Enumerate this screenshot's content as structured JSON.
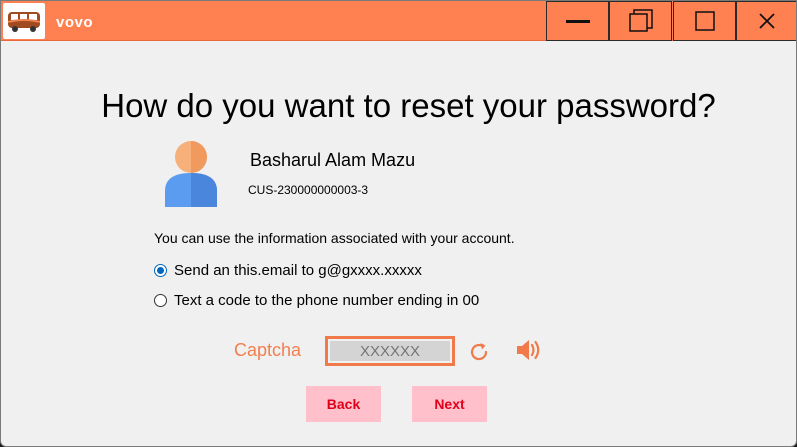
{
  "window": {
    "title": "vovo"
  },
  "heading": "How do you want to reset your password?",
  "user": {
    "name": "Basharul  Alam Mazu",
    "customer_id": "CUS-230000000003-3"
  },
  "info_text": "You can use the information associated with your account.",
  "options": [
    {
      "label": "Send an this.email to g@gxxxx.xxxxx",
      "selected": true
    },
    {
      "label": "Text a code to the phone number ending in 00",
      "selected": false
    }
  ],
  "captcha": {
    "label": "Captcha",
    "placeholder": "XXXXXX"
  },
  "buttons": {
    "back": "Back",
    "next": "Next"
  },
  "colors": {
    "titlebar": "#ff8050",
    "accent": "#f08050",
    "button_bg": "#ffc0cb",
    "button_text": "#e0001a",
    "radio": "#0067c0"
  },
  "icons": {
    "logo": "bus-logo-icon",
    "refresh": "refresh-icon",
    "audio": "speaker-icon"
  }
}
